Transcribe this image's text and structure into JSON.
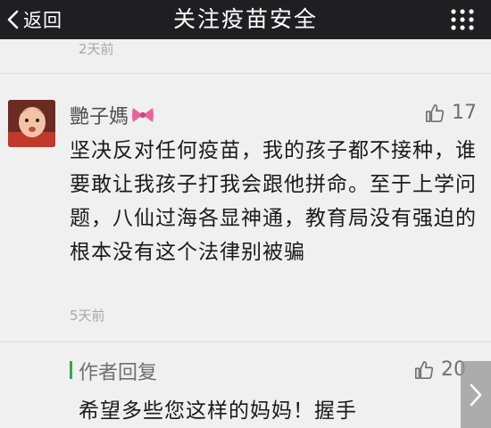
{
  "header": {
    "back_label": "返回",
    "title": "关注疫苗安全"
  },
  "previous_comment": {
    "time": "2天前"
  },
  "comment": {
    "username": "艷子媽",
    "likes": "17",
    "text": "坚决反对任何疫苗，我的孩子都不接种，谁要敢让我孩子打我会跟他拼命。至于上学问题，八仙过海各显神通，教育局没有强迫的根本没有这个法律别被骗",
    "time": "5天前"
  },
  "reply": {
    "label": "作者回复",
    "likes": "20",
    "text": "希望多些您这样的妈妈！握手"
  },
  "icons": {
    "back": "chevron-left-icon",
    "more": "more-dots-icon",
    "like": "thumbs-up-icon",
    "bow": "bow-emoji-icon",
    "next": "chevron-right-icon"
  },
  "colors": {
    "topbar": "#1f1f21",
    "background": "#f0f0f0",
    "reply_accent": "#2fa84f",
    "bow": "#e8659c"
  }
}
